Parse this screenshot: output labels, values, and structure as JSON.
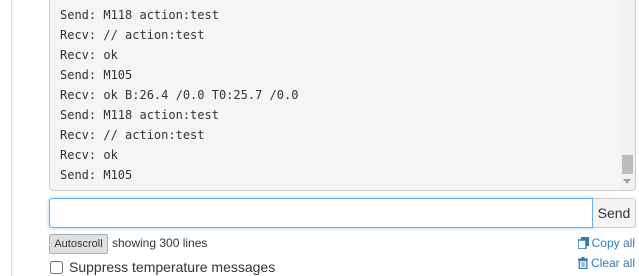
{
  "terminal": {
    "lines": [
      "Send: M118 action:test",
      "Recv: // action:test",
      "Recv: ok",
      "Send: M105",
      "Recv: ok B:26.4 /0.0 T0:25.7 /0.0",
      "Send: M118 action:test",
      "Recv: // action:test",
      "Recv: ok",
      "Send: M105"
    ]
  },
  "command": {
    "value": "",
    "send_label": "Send"
  },
  "controls": {
    "autoscroll_label": "Autoscroll",
    "line_count_text": "showing 300 lines",
    "copy_all_label": "Copy all",
    "clear_all_label": "Clear all",
    "suppress_label": "Suppress temperature messages"
  },
  "colors": {
    "link": "#337ab7",
    "focus_border": "#66afe9",
    "terminal_bg": "#f5f5f5"
  },
  "icons": {
    "copy": "copy-icon",
    "clear": "trash-icon"
  }
}
